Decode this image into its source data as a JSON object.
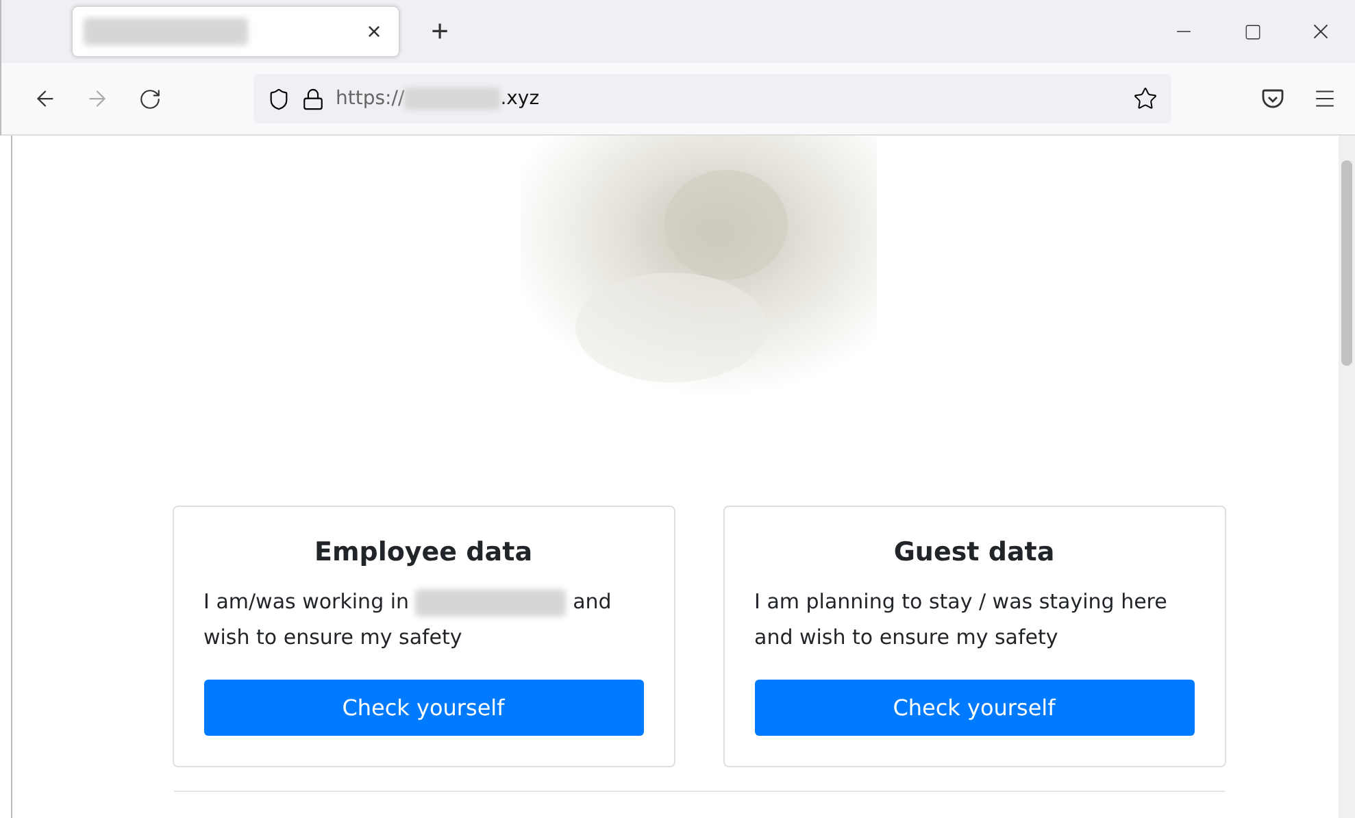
{
  "browser": {
    "tab": {
      "close": "×",
      "new_tab": "+"
    },
    "address": {
      "prefix": "https://",
      "suffix": ".xyz"
    }
  },
  "page": {
    "cards": [
      {
        "title": "Employee data",
        "text_before": "I am/was working in",
        "redacted": true,
        "text_after": "and wish to ensure my safety",
        "button": "Check yourself"
      },
      {
        "title": "Guest data",
        "text_before": "I am planning to stay / was staying here and wish to ensure my safety",
        "redacted": false,
        "button": "Check yourself"
      }
    ]
  }
}
